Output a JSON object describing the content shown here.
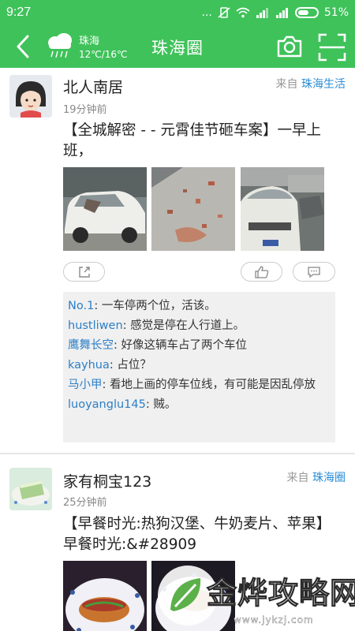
{
  "status_bar": {
    "time": "9:27",
    "dots": "...",
    "battery_percent": "51%"
  },
  "app_bar": {
    "title": "珠海圈",
    "weather_city": "珠海",
    "weather_temp": "12℃/16℃",
    "weather_icon": "cloud-rain-icon"
  },
  "posts": [
    {
      "author": "北人南居",
      "time_ago": "19分钟前",
      "source_prefix": "来自",
      "source_name": "珠海生活",
      "text": "【全城解密 - - 元霄佳节砸车案】一早上班，",
      "photos": [
        "broken-car-photo",
        "rubble-photo",
        "damaged-car-photo"
      ],
      "actions": {
        "share": "share-icon",
        "like": "thumb-up-icon",
        "comment": "comment-icon"
      },
      "comments": [
        {
          "name": "No.1",
          "text": "一车停两个位，活该。"
        },
        {
          "name": "hustliwen",
          "text": "感觉是停在人行道上。"
        },
        {
          "name": "鹰舞长空",
          "text": "好像这辆车占了两个车位"
        },
        {
          "name": "kayhua",
          "text": "占位？"
        },
        {
          "name": "马小甲",
          "text": "看地上画的停车位线，有可能是因乱停放"
        },
        {
          "name": "luoyanglu145",
          "text": "贼。"
        }
      ]
    },
    {
      "author": "家有桐宝123",
      "time_ago": "25分钟前",
      "source_prefix": "来自",
      "source_name": "珠海圈",
      "text": "【早餐时光:热狗汉堡、牛奶麦片、苹果】早餐时光:&#28909",
      "photos": [
        "hotdog-photo",
        "breakfast-photo"
      ]
    }
  ],
  "watermark": {
    "name": "金烨攻略网",
    "url": "www.jykzj.com"
  },
  "colors": {
    "accent": "#3fc25a",
    "link": "#2a8cd6",
    "commenter": "#2c7fc7"
  }
}
